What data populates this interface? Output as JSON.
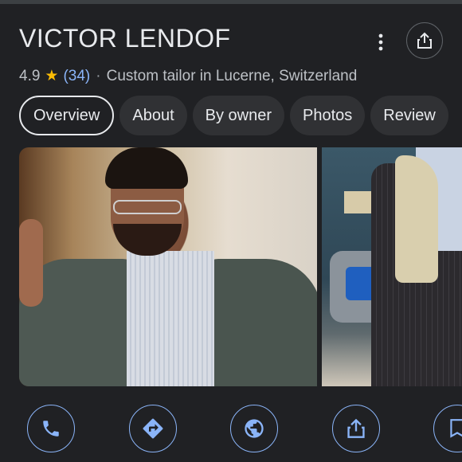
{
  "place": {
    "title": "VICTOR LENDOF",
    "rating": "4.9",
    "rating_star": "★",
    "review_count": "(34)",
    "separator": "·",
    "category_location": "Custom tailor in Lucerne, Switzerland"
  },
  "header_actions": {
    "more_icon": "more-vert-icon",
    "share_icon": "share-icon"
  },
  "tabs": [
    {
      "label": "Overview",
      "active": true
    },
    {
      "label": "About",
      "active": false
    },
    {
      "label": "By owner",
      "active": false
    },
    {
      "label": "Photos",
      "active": false
    },
    {
      "label": "Review",
      "active": false
    }
  ],
  "photos": [
    {
      "subject": "man-in-grey-suit-peace-sign"
    },
    {
      "subject": "pinstripe-suit-on-mannequin"
    }
  ],
  "actions": [
    {
      "icon": "phone-icon"
    },
    {
      "icon": "directions-icon"
    },
    {
      "icon": "website-icon"
    },
    {
      "icon": "share-icon"
    },
    {
      "icon": "save-icon"
    }
  ],
  "colors": {
    "background": "#202124",
    "accent": "#8ab4f8",
    "star": "#fbbc04",
    "chip": "#303134"
  }
}
